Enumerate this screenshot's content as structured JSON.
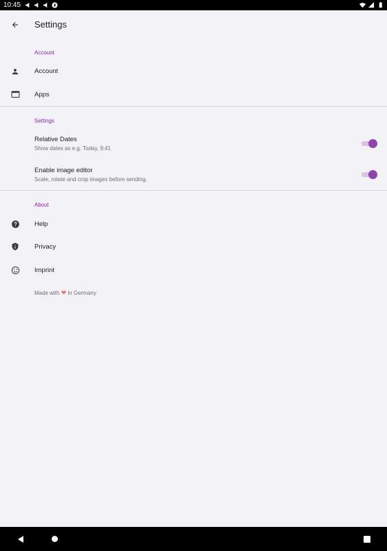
{
  "status_bar": {
    "time": "10:45",
    "left_icons": [
      "megaphone-icon",
      "megaphone-icon",
      "megaphone-icon",
      "app-badge-icon"
    ],
    "right_icons": [
      "wifi-icon",
      "signal-icon",
      "battery-icon"
    ]
  },
  "app_bar": {
    "title": "Settings",
    "back_icon": "arrow-back-icon"
  },
  "sections": {
    "account": {
      "header": "Account",
      "items": [
        {
          "label": "Account",
          "icon": "person-icon"
        },
        {
          "label": "Apps",
          "icon": "window-icon"
        }
      ]
    },
    "settings": {
      "header": "Settings",
      "items": [
        {
          "label": "Relative Dates",
          "subtitle": "Show dates as e.g. Today, 9:41",
          "enabled": true
        },
        {
          "label": "Enable image editor",
          "subtitle": "Scale, rotate and crop images before sending.",
          "enabled": true
        }
      ]
    },
    "about": {
      "header": "About",
      "items": [
        {
          "label": "Help",
          "icon": "help-icon"
        },
        {
          "label": "Privacy",
          "icon": "shield-icon"
        },
        {
          "label": "Imprint",
          "icon": "smiley-icon"
        }
      ]
    }
  },
  "footer": {
    "made_with_prefix": "Made with",
    "heart": "❤",
    "made_with_suffix": "in Germany"
  },
  "colors": {
    "accent": "#8e24aa",
    "switch_thumb": "#8e44ad",
    "switch_track": "#d9c2e3",
    "background": "#f2f2f7",
    "heart": "#f36b6b"
  },
  "nav_bar": {
    "icons": [
      "nav-back-icon",
      "nav-home-icon",
      "nav-recents-icon"
    ]
  }
}
